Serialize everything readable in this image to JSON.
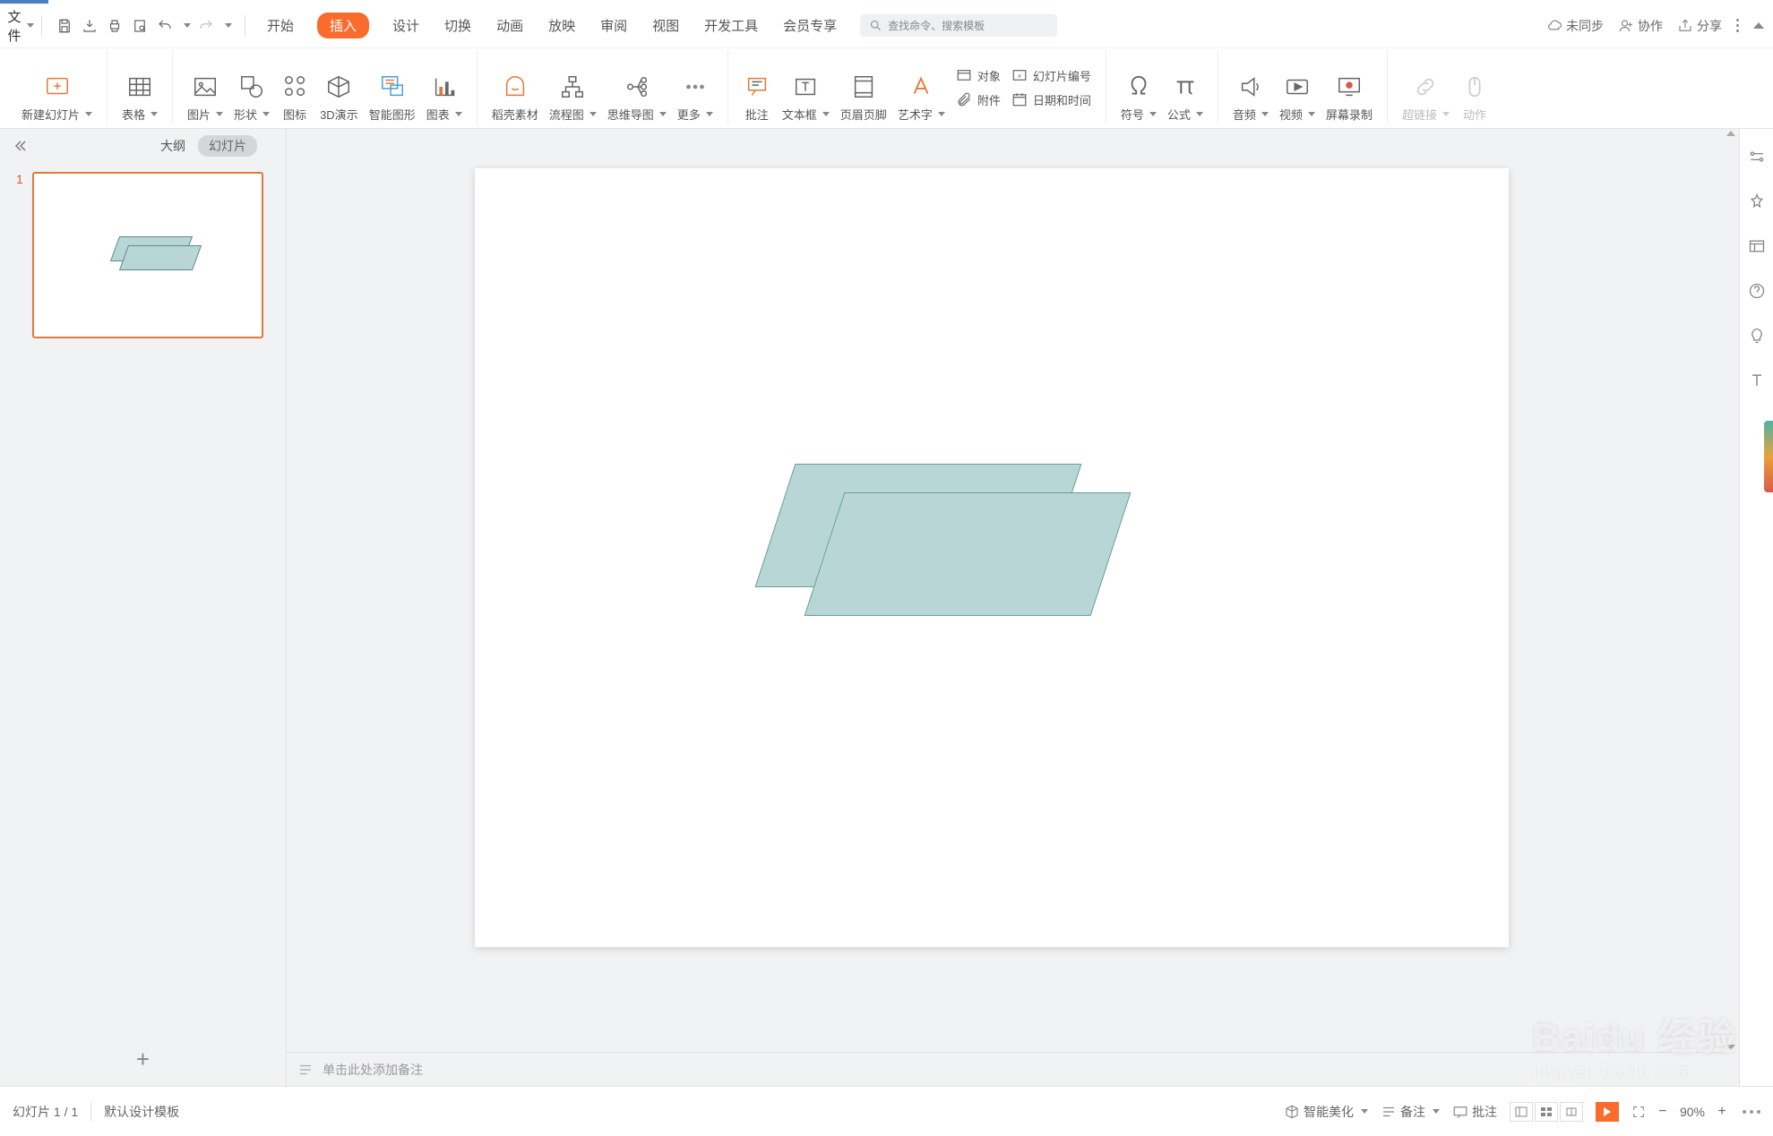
{
  "file_menu": "文件",
  "tabs": {
    "start": "开始",
    "insert": "插入",
    "design": "设计",
    "transition": "切换",
    "animation": "动画",
    "slideshow": "放映",
    "review": "审阅",
    "view": "视图",
    "devtools": "开发工具",
    "member": "会员专享"
  },
  "search_placeholder": "查找命令、搜索模板",
  "top_right": {
    "unsync": "未同步",
    "collab": "协作",
    "share": "分享"
  },
  "ribbon": {
    "new_slide": "新建幻灯片",
    "table": "表格",
    "picture": "图片",
    "shape": "形状",
    "icon": "图标",
    "threeD": "3D演示",
    "smartart": "智能图形",
    "chart": "图表",
    "docer": "稻壳素材",
    "flowchart": "流程图",
    "mindmap": "思维导图",
    "more": "更多",
    "annotate": "批注",
    "textbox": "文本框",
    "headerfooter": "页眉页脚",
    "wordart": "艺术字",
    "object": "对象",
    "slidenum": "幻灯片编号",
    "attach": "附件",
    "datetime": "日期和时间",
    "symbol": "符号",
    "formula": "公式",
    "audio": "音频",
    "video": "视频",
    "screenrec": "屏幕录制",
    "hyperlink": "超链接",
    "action": "动作"
  },
  "pane": {
    "outline": "大纲",
    "slides": "幻灯片",
    "slide_index": "1"
  },
  "notes_placeholder": "单击此处添加备注",
  "status": {
    "slide_counter": "幻灯片 1 / 1",
    "template": "默认设计模板",
    "beautify": "智能美化",
    "notes": "备注",
    "comments": "批注",
    "zoom": "90%"
  },
  "watermark": {
    "main": "Baidu 经验",
    "sub": "jingyan.baidu.com"
  }
}
